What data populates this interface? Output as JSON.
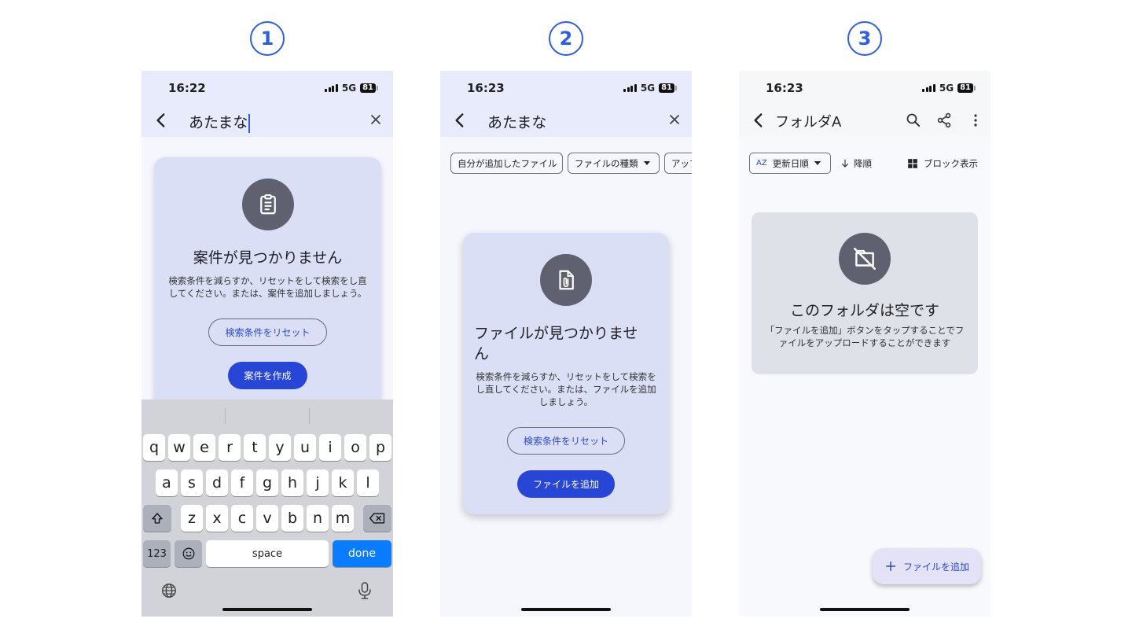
{
  "steps": [
    "1",
    "2",
    "3"
  ],
  "screen1": {
    "time": "16:22",
    "network": "5G",
    "battery": "81",
    "search_text": "あたまな",
    "empty": {
      "icon": "clipboard-icon",
      "title": "案件が見つかりません",
      "desc_line1": "検索条件を減らすか、リセットをして検索をし直",
      "desc_line2": "してください。または、案件を追加しましょう。",
      "reset_label": "検索条件をリセット",
      "create_label": "案件を作成"
    },
    "keyboard": {
      "row1": [
        "q",
        "w",
        "e",
        "r",
        "t",
        "y",
        "u",
        "i",
        "o",
        "p"
      ],
      "row2": [
        "a",
        "s",
        "d",
        "f",
        "g",
        "h",
        "j",
        "k",
        "l"
      ],
      "row3": [
        "z",
        "x",
        "c",
        "v",
        "b",
        "n",
        "m"
      ],
      "numbers_label": "123",
      "space_label": "space",
      "done_label": "done"
    }
  },
  "screen2": {
    "time": "16:23",
    "network": "5G",
    "battery": "81",
    "search_text": "あたまな",
    "chips": {
      "mine": "自分が追加したファイル",
      "type": "ファイルの種類",
      "upload": "アップ"
    },
    "empty": {
      "icon": "file-attachment-icon",
      "title_line1": "ファイルが見つかりませ",
      "title_line2": "ん",
      "desc_line1": "検索条件を減らすか、リセットをして検索を",
      "desc_line2": "し直してください。または、ファイルを追加",
      "desc_line3": "しましょう。",
      "reset_label": "検索条件をリセット",
      "add_label": "ファイルを追加"
    }
  },
  "screen3": {
    "time": "16:23",
    "network": "5G",
    "battery": "81",
    "title": "フォルダA",
    "sort_icon_label": "AZ",
    "sort_label": "更新日順",
    "order_label": "降順",
    "view_label": "ブロック表示",
    "empty": {
      "icon": "empty-folder-icon",
      "title": "このフォルダは空です",
      "desc_line1": "「ファイルを追加」ボタンをタップすることでフ",
      "desc_line2": "ァイルをアップロードすることができます"
    },
    "fab_label": "ファイルを追加"
  }
}
